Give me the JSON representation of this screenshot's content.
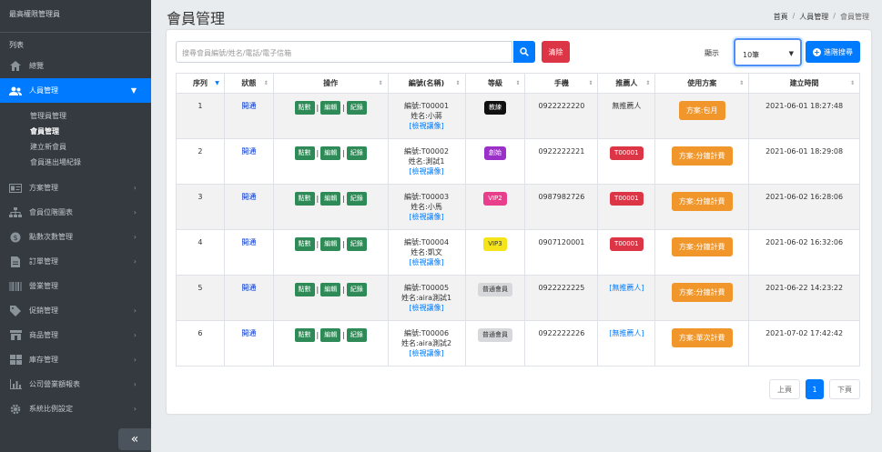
{
  "sidebar": {
    "brand": "最高權限管理員",
    "section_title": "列表",
    "items": [
      {
        "label": "總覽",
        "icon": "home-icon"
      },
      {
        "label": "人員管理",
        "icon": "users-icon",
        "active": true
      },
      {
        "label": "方案管理",
        "icon": "id-card-icon"
      },
      {
        "label": "會員位階圖表",
        "icon": "sitemap-icon"
      },
      {
        "label": "點數次數管理",
        "icon": "dollar-icon"
      },
      {
        "label": "訂單管理",
        "icon": "file-icon"
      },
      {
        "label": "營業管理",
        "icon": "barcode-icon"
      },
      {
        "label": "促銷管理",
        "icon": "tag-icon"
      },
      {
        "label": "商品管理",
        "icon": "store-icon"
      },
      {
        "label": "庫存管理",
        "icon": "inventory-icon"
      },
      {
        "label": "公司營業額報表",
        "icon": "chart-icon"
      },
      {
        "label": "系統比例設定",
        "icon": "gear-icon"
      }
    ],
    "subitems": [
      "管理員管理",
      "會員管理",
      "建立新會員",
      "會員進出場紀錄"
    ],
    "collapse": "«"
  },
  "header": {
    "title": "會員管理",
    "breadcrumb": [
      "首頁",
      "人員管理",
      "會員管理"
    ]
  },
  "toolbar": {
    "search_placeholder": "搜尋會員編號/姓名/電話/電子信箱",
    "clear_label": "清除",
    "show_label": "顯示",
    "page_size": "10筆",
    "advanced_label": "進階搜尋"
  },
  "table": {
    "headers": [
      "序列",
      "狀態",
      "操作",
      "編號(名稱)",
      "等級",
      "手機",
      "推薦人",
      "使用方案",
      "建立時間"
    ],
    "op_labels": [
      "點數",
      "編輯",
      "紀錄"
    ],
    "view_label": "[檢視讓像]",
    "rows": [
      {
        "seq": "1",
        "status": "開通",
        "id": "編號:T00001",
        "name": "姓名:小蔣",
        "level": "教練",
        "level_bg": "#111111",
        "level_fg": "#ffffff",
        "phone": "0922222220",
        "ref": "無推薦人",
        "ref_type": "text",
        "plan": "方案:包月",
        "created": "2021-06-01 18:27:48"
      },
      {
        "seq": "2",
        "status": "開通",
        "id": "編號:T00002",
        "name": "姓名:測試1",
        "level": "創始",
        "level_bg": "#9b30c8",
        "level_fg": "#ffffff",
        "phone": "0922222221",
        "ref": "T00001",
        "ref_type": "red",
        "plan": "方案:分鐘計費",
        "created": "2021-06-01 18:29:08"
      },
      {
        "seq": "3",
        "status": "開通",
        "id": "編號:T00003",
        "name": "姓名:小馬",
        "level": "VIP2",
        "level_bg": "#e83e8c",
        "level_fg": "#ffffff",
        "phone": "0987982726",
        "ref": "T00001",
        "ref_type": "red",
        "plan": "方案:分鐘計費",
        "created": "2021-06-02 16:28:06"
      },
      {
        "seq": "4",
        "status": "開通",
        "id": "編號:T00004",
        "name": "姓名:凱文",
        "level": "VIP3",
        "level_bg": "#f5e41a",
        "level_fg": "#333333",
        "phone": "0907120001",
        "ref": "T00001",
        "ref_type": "red",
        "plan": "方案:分鐘計費",
        "created": "2021-06-02 16:32:06"
      },
      {
        "seq": "5",
        "status": "開通",
        "id": "編號:T00005",
        "name": "姓名:aira測試1",
        "level": "普通會員",
        "level_bg": "#d6d8db",
        "level_fg": "#333333",
        "phone": "0922222225",
        "ref": "[無推薦人]",
        "ref_type": "link",
        "plan": "方案:分鐘計費",
        "created": "2021-06-22 14:23:22"
      },
      {
        "seq": "6",
        "status": "開通",
        "id": "編號:T00006",
        "name": "姓名:aira測試2",
        "level": "普通會員",
        "level_bg": "#d6d8db",
        "level_fg": "#333333",
        "phone": "0922222226",
        "ref": "[無推薦人]",
        "ref_type": "link",
        "plan": "方案:單次計費",
        "created": "2021-07-02 17:42:42"
      }
    ]
  },
  "pagination": {
    "prev": "上頁",
    "current": "1",
    "next": "下頁"
  },
  "colors": {
    "primary": "#007bff",
    "danger": "#dc3545",
    "warning": "#f0962a",
    "sidebar": "#343a40"
  }
}
